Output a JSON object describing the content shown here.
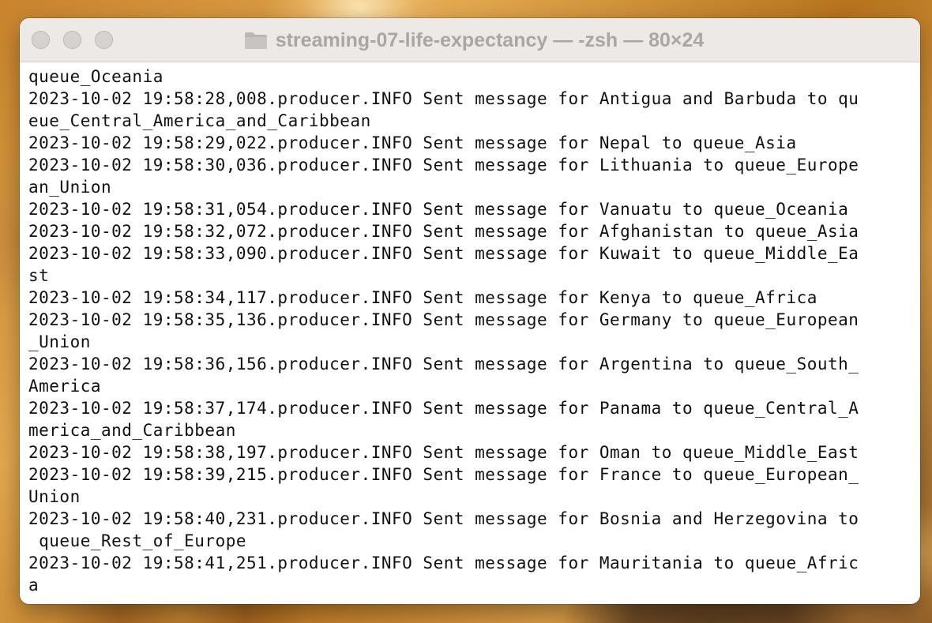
{
  "window": {
    "title": "streaming-07-life-expectancy — -zsh — 80×24"
  },
  "terminal": {
    "lines": [
      "queue_Oceania",
      "2023-10-02 19:58:28,008.producer.INFO Sent message for Antigua and Barbuda to qu",
      "eue_Central_America_and_Caribbean",
      "2023-10-02 19:58:29,022.producer.INFO Sent message for Nepal to queue_Asia",
      "2023-10-02 19:58:30,036.producer.INFO Sent message for Lithuania to queue_Europe",
      "an_Union",
      "2023-10-02 19:58:31,054.producer.INFO Sent message for Vanuatu to queue_Oceania",
      "2023-10-02 19:58:32,072.producer.INFO Sent message for Afghanistan to queue_Asia",
      "2023-10-02 19:58:33,090.producer.INFO Sent message for Kuwait to queue_Middle_Ea",
      "st",
      "2023-10-02 19:58:34,117.producer.INFO Sent message for Kenya to queue_Africa",
      "2023-10-02 19:58:35,136.producer.INFO Sent message for Germany to queue_European",
      "_Union",
      "2023-10-02 19:58:36,156.producer.INFO Sent message for Argentina to queue_South_",
      "America",
      "2023-10-02 19:58:37,174.producer.INFO Sent message for Panama to queue_Central_A",
      "merica_and_Caribbean",
      "2023-10-02 19:58:38,197.producer.INFO Sent message for Oman to queue_Middle_East",
      "2023-10-02 19:58:39,215.producer.INFO Sent message for France to queue_European_",
      "Union",
      "2023-10-02 19:58:40,231.producer.INFO Sent message for Bosnia and Herzegovina to",
      " queue_Rest_of_Europe",
      "2023-10-02 19:58:41,251.producer.INFO Sent message for Mauritania to queue_Afric",
      "a"
    ]
  },
  "icons": {
    "folder": "folder-icon",
    "close": "close-button",
    "minimize": "minimize-button",
    "zoom": "zoom-button"
  },
  "colors": {
    "title_text": "#a9a6a3",
    "titlebar_bg": "#ece9e6",
    "terminal_bg": "#ffffff",
    "terminal_text": "#111111"
  }
}
